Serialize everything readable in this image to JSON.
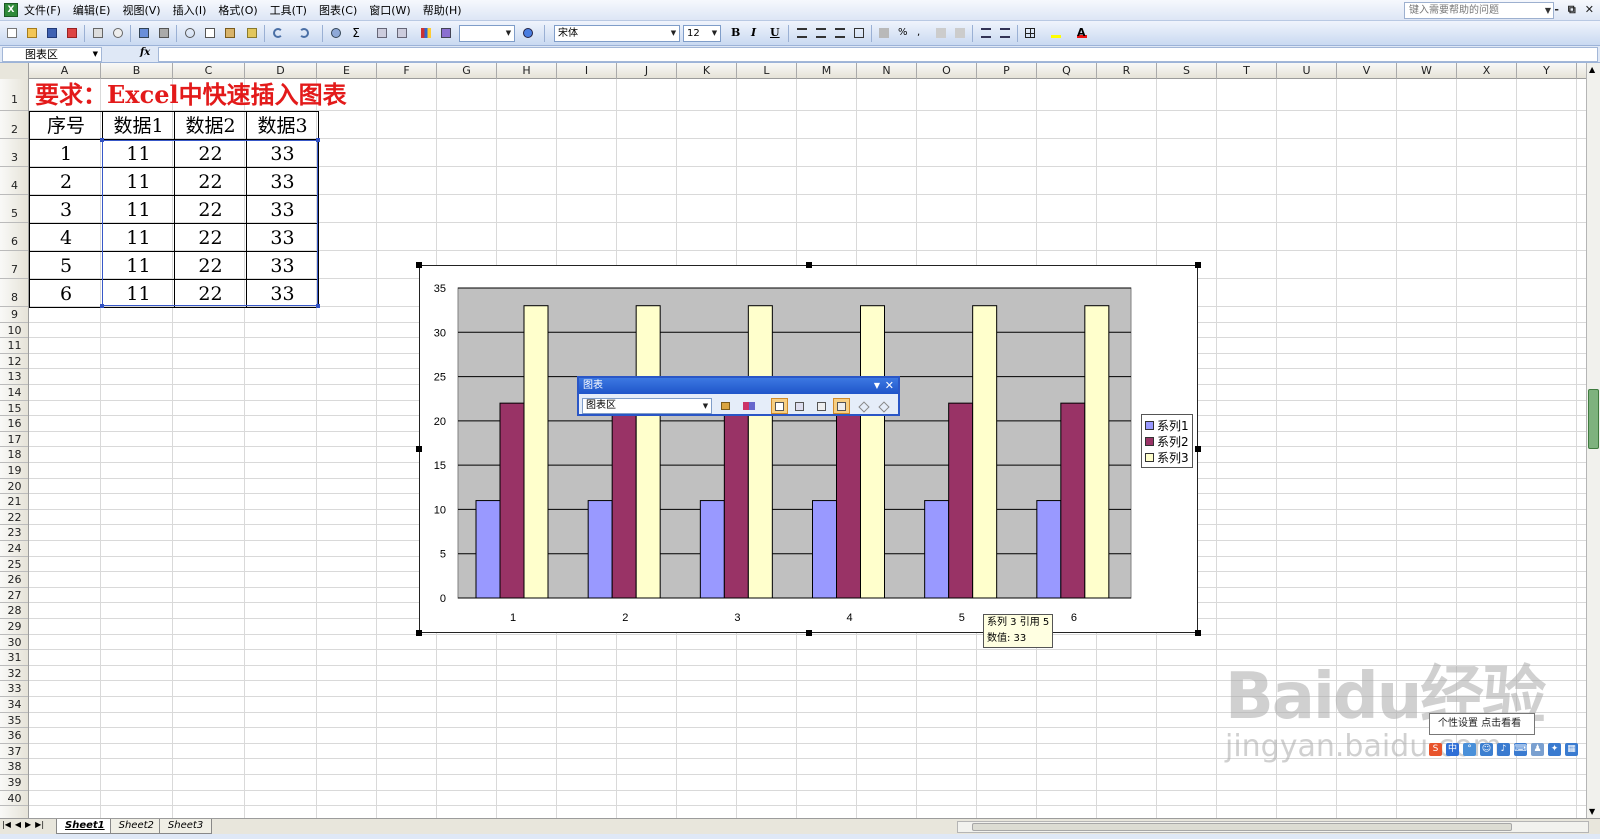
{
  "menubar": {
    "items": [
      "文件(F)",
      "编辑(E)",
      "视图(V)",
      "插入(I)",
      "格式(O)",
      "工具(T)",
      "图表(C)",
      "窗口(W)",
      "帮助(H)"
    ],
    "help_placeholder": "键入需要帮助的问题",
    "window_buttons": [
      "-",
      "⧉",
      "✕"
    ]
  },
  "toolbar": {
    "font": "宋体",
    "size": "12",
    "bold": "B",
    "italic": "I",
    "underline": "U"
  },
  "formula_bar": {
    "name_box": "图表区",
    "fx": "fx",
    "formula": ""
  },
  "columns": [
    "A",
    "B",
    "C",
    "D",
    "E",
    "F",
    "G",
    "H",
    "I",
    "J",
    "K",
    "L",
    "M",
    "N",
    "O",
    "P",
    "Q",
    "R",
    "S",
    "T",
    "U",
    "V",
    "W",
    "X",
    "Y"
  ],
  "rows": [
    "1",
    "2",
    "3",
    "4",
    "5",
    "6",
    "7",
    "8",
    "9",
    "10",
    "11",
    "12",
    "13",
    "14",
    "15",
    "16",
    "17",
    "18",
    "19",
    "20",
    "21",
    "22",
    "23",
    "24",
    "25",
    "26",
    "27",
    "28",
    "29",
    "30",
    "31",
    "32",
    "33",
    "34",
    "35",
    "36",
    "37",
    "38",
    "39",
    "40"
  ],
  "sheet": {
    "title": "要求：Excel中快速插入图表",
    "headers": [
      "序号",
      "数据1",
      "数据2",
      "数据3"
    ],
    "rows": [
      [
        "1",
        "11",
        "22",
        "33"
      ],
      [
        "2",
        "11",
        "22",
        "33"
      ],
      [
        "3",
        "11",
        "22",
        "33"
      ],
      [
        "4",
        "11",
        "22",
        "33"
      ],
      [
        "5",
        "11",
        "22",
        "33"
      ],
      [
        "6",
        "11",
        "22",
        "33"
      ]
    ]
  },
  "chart_data": {
    "type": "bar",
    "categories": [
      "1",
      "2",
      "3",
      "4",
      "5",
      "6"
    ],
    "series": [
      {
        "name": "系列1",
        "values": [
          11,
          11,
          11,
          11,
          11,
          11
        ],
        "color": "#9999ff"
      },
      {
        "name": "系列2",
        "values": [
          22,
          22,
          22,
          22,
          22,
          22
        ],
        "color": "#993366"
      },
      {
        "name": "系列3",
        "values": [
          33,
          33,
          33,
          33,
          33,
          33
        ],
        "color": "#ffffcc"
      }
    ],
    "yticks": [
      "0",
      "5",
      "10",
      "15",
      "20",
      "25",
      "30",
      "35"
    ],
    "ylim": [
      0,
      35
    ],
    "plot_background": "#c0c0c0",
    "grid": true,
    "legend_position": "right"
  },
  "tooltip": {
    "line1": "系列 3 引用 5",
    "line2": "数值: 33"
  },
  "chart_toolbar": {
    "title": "图表",
    "select": "图表区"
  },
  "sheet_tabs": [
    "Sheet1",
    "Sheet2",
    "Sheet3"
  ],
  "watermark": {
    "logo": "Baidu经验",
    "url": "jingyan.baidu.com",
    "popup": "个性设置  点击看看"
  },
  "ime": {
    "label": "中"
  }
}
